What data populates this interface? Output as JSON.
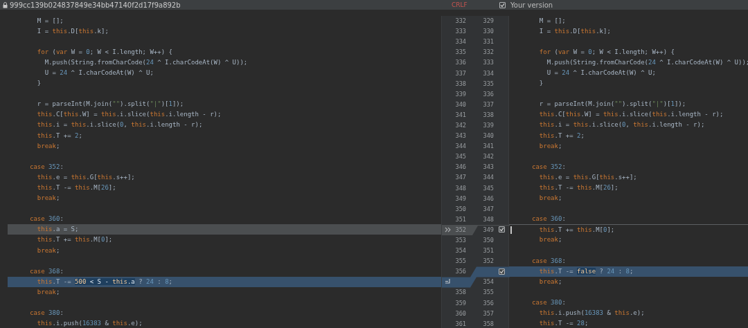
{
  "header": {
    "title": "999cc139b024837849e34bb47140f2d17f9a892b",
    "line_separator": "CRLF",
    "right_label": "Your version",
    "right_checked": true
  },
  "left_pane": {
    "lines": [
      {
        "kind": "plain",
        "number": "332",
        "code": "  M = [];"
      },
      {
        "kind": "plain",
        "number": "333",
        "code": "  I = this.D[this.k];"
      },
      {
        "kind": "plain",
        "number": "334"
      },
      {
        "kind": "plain",
        "number": "335",
        "code": "  for (var W = 0; W < I.length; W++) {"
      },
      {
        "kind": "plain",
        "number": "336",
        "code": "    M.push(String.fromCharCode(24 ^ I.charCodeAt(W) ^ U));"
      },
      {
        "kind": "plain",
        "number": "337",
        "code": "    U = 24 ^ I.charCodeAt(W) ^ U;"
      },
      {
        "kind": "plain",
        "number": "338",
        "code": "  }"
      },
      {
        "kind": "plain",
        "number": "339"
      },
      {
        "kind": "plain",
        "number": "340",
        "code": "  r = parseInt(M.join(\"\").split(\"|\")[1]);"
      },
      {
        "kind": "plain",
        "number": "341",
        "code": "  this.C[this.W] = this.i.slice(this.i.length - r);"
      },
      {
        "kind": "plain",
        "number": "342",
        "code": "  this.i = this.i.slice(0, this.i.length - r);"
      },
      {
        "kind": "plain",
        "number": "343",
        "code": "  this.T += 2;"
      },
      {
        "kind": "plain",
        "number": "344",
        "code": "  break;"
      },
      {
        "kind": "plain",
        "number": "345"
      },
      {
        "kind": "plain",
        "number": "346",
        "code": "case 352:"
      },
      {
        "kind": "plain",
        "number": "347",
        "code": "  this.e = this.G[this.s++];"
      },
      {
        "kind": "plain",
        "number": "348",
        "code": "  this.T -= this.M[26];"
      },
      {
        "kind": "plain",
        "number": "349",
        "code": "  break;"
      },
      {
        "kind": "plain",
        "number": "350"
      },
      {
        "kind": "plain",
        "number": "351",
        "code": "case 360:"
      },
      {
        "kind": "deleted",
        "number": "352",
        "code": "  this.a = S;"
      },
      {
        "kind": "plain",
        "number": "353",
        "code": "  this.T += this.M[0];"
      },
      {
        "kind": "plain",
        "number": "354",
        "code": "  break;"
      },
      {
        "kind": "plain",
        "number": "355"
      },
      {
        "kind": "plain",
        "number": "356",
        "code": "case 368:"
      },
      {
        "kind": "modified",
        "parts": [
          {
            "text": "  this.T -= ",
            "marked": false
          },
          {
            "text": "500 < S - this.a",
            "marked": true
          },
          {
            "text": " ? 24 : 8;",
            "marked": false
          }
        ]
      },
      {
        "kind": "plain",
        "number": "358",
        "code": "  break;"
      },
      {
        "kind": "plain",
        "number": "359"
      },
      {
        "kind": "plain",
        "number": "360",
        "code": "case 380:"
      },
      {
        "kind": "plain",
        "number": "361",
        "code": "  this.i.push(16383 & this.e);"
      }
    ]
  },
  "right_pane": {
    "lines": [
      {
        "kind": "plain",
        "number": "329",
        "code": "  M = [];"
      },
      {
        "kind": "plain",
        "number": "330",
        "code": "  I = this.D[this.k];"
      },
      {
        "kind": "plain",
        "number": "331"
      },
      {
        "kind": "plain",
        "number": "332",
        "code": "  for (var W = 0; W < I.length; W++) {"
      },
      {
        "kind": "plain",
        "number": "333",
        "code": "    M.push(String.fromCharCode(24 ^ I.charCodeAt(W) ^ U));"
      },
      {
        "kind": "plain",
        "number": "334",
        "code": "    U = 24 ^ I.charCodeAt(W) ^ U;"
      },
      {
        "kind": "plain",
        "number": "335",
        "code": "  }"
      },
      {
        "kind": "plain",
        "number": "336"
      },
      {
        "kind": "plain",
        "number": "337",
        "code": "  r = parseInt(M.join(\"\").split(\"|\")[1]);"
      },
      {
        "kind": "plain",
        "number": "338",
        "code": "  this.C[this.W] = this.i.slice(this.i.length - r);"
      },
      {
        "kind": "plain",
        "number": "339",
        "code": "  this.i = this.i.slice(0, this.i.length - r);"
      },
      {
        "kind": "plain",
        "number": "340",
        "code": "  this.T += 2;"
      },
      {
        "kind": "plain",
        "number": "341",
        "code": "  break;"
      },
      {
        "kind": "plain",
        "number": "342"
      },
      {
        "kind": "plain",
        "number": "343",
        "code": "case 352:"
      },
      {
        "kind": "plain",
        "number": "344",
        "code": "  this.e = this.G[this.s++];"
      },
      {
        "kind": "plain",
        "number": "345",
        "code": "  this.T -= this.M[26];"
      },
      {
        "kind": "plain",
        "number": "346",
        "code": "  break;"
      },
      {
        "kind": "plain",
        "number": "347"
      },
      {
        "kind": "plain",
        "number": "348",
        "code": "case 360:"
      },
      {
        "kind": "deletion_point",
        "number": "349",
        "code": "  this.T += this.M[0];",
        "checked": true,
        "cursor": true
      },
      {
        "kind": "plain",
        "number": "350",
        "code": "  break;"
      },
      {
        "kind": "plain",
        "number": "351"
      },
      {
        "kind": "plain",
        "number": "352",
        "code": "case 368:"
      },
      {
        "kind": "modified",
        "parts": [
          {
            "text": "  this.T -= ",
            "marked": false
          },
          {
            "text": "false",
            "marked": true
          },
          {
            "text": " ? 24 : 8;",
            "marked": false
          }
        ],
        "checked": true
      },
      {
        "kind": "plain",
        "number": "354",
        "code": "  break;"
      },
      {
        "kind": "plain",
        "number": "355"
      },
      {
        "kind": "plain",
        "number": "356",
        "code": "case 380:"
      },
      {
        "kind": "plain",
        "number": "357",
        "code": "  this.i.push(16383 & this.e);"
      },
      {
        "kind": "plain",
        "number": "358",
        "code": "  this.T -= 28;"
      }
    ]
  }
}
